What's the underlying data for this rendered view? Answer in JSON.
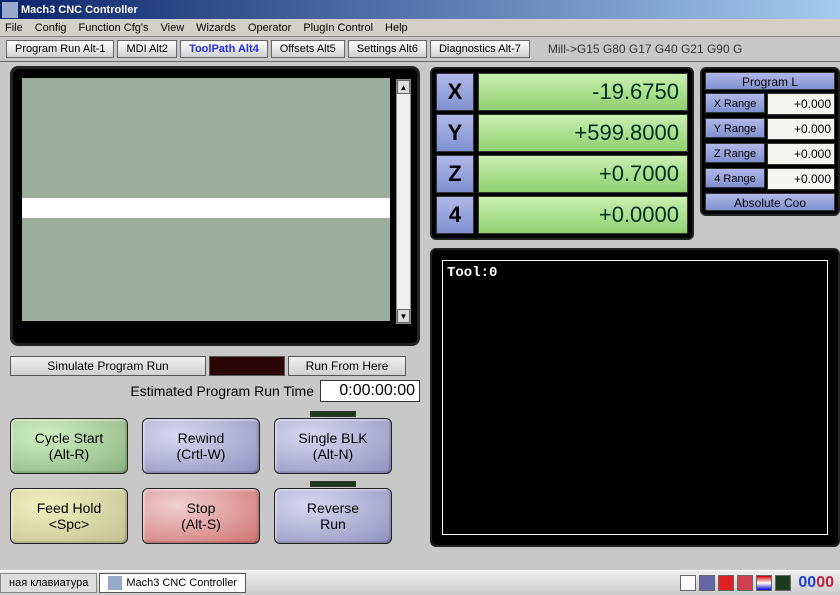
{
  "title": "Mach3 CNC Controller",
  "menu": [
    "File",
    "Config",
    "Function Cfg's",
    "View",
    "Wizards",
    "Operator",
    "PlugIn Control",
    "Help"
  ],
  "tabs": [
    {
      "label": "Program Run Alt-1",
      "active": false
    },
    {
      "label": "MDI Alt2",
      "active": false
    },
    {
      "label": "ToolPath Alt4",
      "active": true
    },
    {
      "label": "Offsets Alt5",
      "active": false
    },
    {
      "label": "Settings Alt6",
      "active": false
    },
    {
      "label": "Diagnostics Alt-7",
      "active": false
    }
  ],
  "gcode_status": "Mill->G15  G80 G17 G40 G21 G90 G",
  "sim": {
    "simulate": "Simulate Program Run",
    "run_here": "Run From Here",
    "est_label": "Estimated Program Run Time",
    "est_time": "0:00:00:00"
  },
  "buttons": {
    "cycle1": "Cycle Start",
    "cycle2": "(Alt-R)",
    "rewind1": "Rewind",
    "rewind2": "(Crtl-W)",
    "single1": "Single BLK",
    "single2": "(Alt-N)",
    "feed1": "Feed Hold",
    "feed2": "<Spc>",
    "stop1": "Stop",
    "stop2": "(Alt-S)",
    "rev1": "Reverse",
    "rev2": "Run"
  },
  "dro": [
    {
      "axis": "X",
      "value": "-19.6750"
    },
    {
      "axis": "Y",
      "value": "+599.8000"
    },
    {
      "axis": "Z",
      "value": "+0.7000"
    },
    {
      "axis": "4",
      "value": "+0.0000"
    }
  ],
  "limits": {
    "header": "Program L",
    "rows": [
      {
        "label": "X Range",
        "value": "+0.000"
      },
      {
        "label": "Y Range",
        "value": "+0.000"
      },
      {
        "label": "Z Range",
        "value": "+0.000"
      },
      {
        "label": "4 Range",
        "value": "+0.000"
      }
    ],
    "footer": "Absolute Coo"
  },
  "code_display": "Tool:0",
  "taskbar": {
    "prev": "ная клавиатура",
    "current": "Mach3 CNC Controller",
    "clock_h": "00",
    "clock_m": "00"
  }
}
